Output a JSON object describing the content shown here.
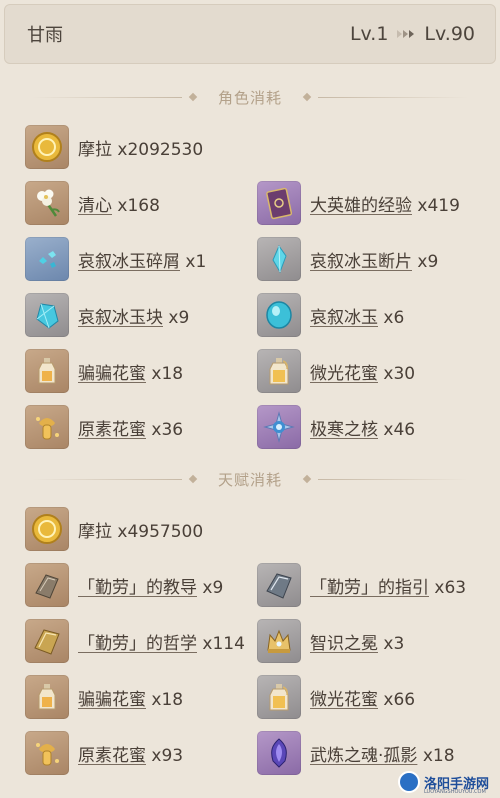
{
  "header": {
    "title": "甘雨",
    "level_from": "Lv.1",
    "level_to": "Lv.90"
  },
  "sections": {
    "character": "角色消耗",
    "talent": "天赋消耗"
  },
  "character_items": [
    {
      "name": "摩拉",
      "qty": "x2092530",
      "icon": "mora-coin-icon"
    },
    {
      "name": "清心",
      "qty": "x168",
      "icon": "qingxin-flower-icon"
    },
    {
      "name": "大英雄的经验",
      "qty": "x419",
      "icon": "heros-wit-book-icon"
    },
    {
      "name": "哀叙冰玉碎屑",
      "qty": "x1",
      "icon": "shivada-jade-sliver-icon"
    },
    {
      "name": "哀叙冰玉断片",
      "qty": "x9",
      "icon": "shivada-jade-fragment-icon"
    },
    {
      "name": "哀叙冰玉块",
      "qty": "x9",
      "icon": "shivada-jade-chunk-icon"
    },
    {
      "name": "哀叙冰玉",
      "qty": "x6",
      "icon": "shivada-jade-gemstone-icon"
    },
    {
      "name": "骗骗花蜜",
      "qty": "x18",
      "icon": "whopperflower-nectar-icon"
    },
    {
      "name": "微光花蜜",
      "qty": "x30",
      "icon": "shimmering-nectar-icon"
    },
    {
      "name": "原素花蜜",
      "qty": "x36",
      "icon": "energy-nectar-icon"
    },
    {
      "name": "极寒之核",
      "qty": "x46",
      "icon": "hoarfrost-core-icon"
    }
  ],
  "talent_items": [
    {
      "name": "摩拉",
      "qty": "x4957500",
      "icon": "mora-coin-icon"
    },
    {
      "name": "「勤劳」的教导",
      "qty": "x9",
      "icon": "teachings-of-diligence-icon"
    },
    {
      "name": "「勤劳」的指引",
      "qty": "x63",
      "icon": "guide-to-diligence-icon"
    },
    {
      "name": "「勤劳」的哲学",
      "qty": "x114",
      "icon": "philosophies-of-diligence-icon"
    },
    {
      "name": "智识之冕",
      "qty": "x3",
      "icon": "crown-of-insight-icon"
    },
    {
      "name": "骗骗花蜜",
      "qty": "x18",
      "icon": "whopperflower-nectar-icon"
    },
    {
      "name": "微光花蜜",
      "qty": "x66",
      "icon": "shimmering-nectar-icon"
    },
    {
      "name": "原素花蜜",
      "qty": "x93",
      "icon": "energy-nectar-icon"
    },
    {
      "name": "武炼之魂·孤影",
      "qty": "x18",
      "icon": "shadow-of-the-warrior-icon"
    }
  ],
  "watermark": {
    "name": "洛阳手游网",
    "sub": "LUOYANGSHOUYOU.COM"
  }
}
